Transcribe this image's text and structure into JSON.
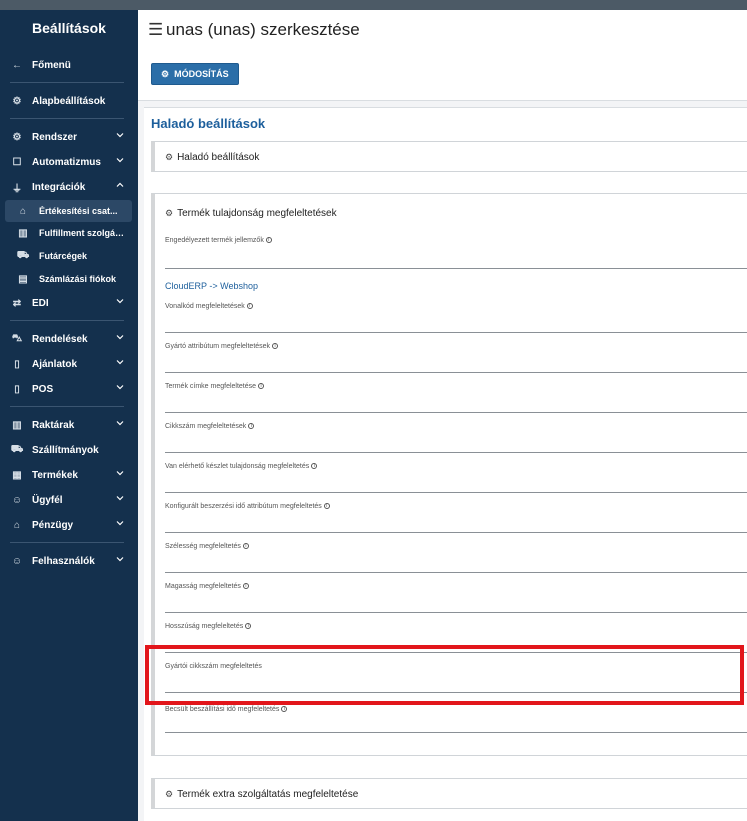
{
  "sidebar": {
    "title": "Beállítások",
    "back": "Főmenü",
    "items": [
      {
        "label": "Alapbeállítások",
        "icon": "gear-icon"
      },
      {
        "label": "Rendszer",
        "icon": "settings-icon"
      },
      {
        "label": "Automatizmus",
        "icon": "robot-icon"
      },
      {
        "label": "Integrációk",
        "icon": "plug-icon"
      },
      {
        "label": "Értékesítési csat...",
        "icon": "basket-icon"
      },
      {
        "label": "Fulfillment szolgált...",
        "icon": "warehouse-icon"
      },
      {
        "label": "Futárcégek",
        "icon": "truck-icon"
      },
      {
        "label": "Számlázási fiókok",
        "icon": "invoice-icon"
      },
      {
        "label": "EDI",
        "icon": "exchange-icon"
      },
      {
        "label": "Rendelések",
        "icon": "cart-icon"
      },
      {
        "label": "Ajánlatok",
        "icon": "document-icon"
      },
      {
        "label": "POS",
        "icon": "pos-icon"
      },
      {
        "label": "Raktárak",
        "icon": "warehouse-icon"
      },
      {
        "label": "Szállítmányok",
        "icon": "truck-icon"
      },
      {
        "label": "Termékek",
        "icon": "boxes-icon"
      },
      {
        "label": "Ügyfél",
        "icon": "users-icon"
      },
      {
        "label": "Pénzügy",
        "icon": "bank-icon"
      },
      {
        "label": "Felhasználók",
        "icon": "users-icon"
      }
    ]
  },
  "header": {
    "title": "unas (unas) szerkesztése",
    "save_label": "MÓDOSÍTÁS"
  },
  "card": {
    "title": "Haladó beállítások",
    "panel1_title": "Haladó beállítások",
    "panel2_title": "Termék tulajdonság megfeleltetések",
    "allowed_label": "Engedélyezett termék jellemzők",
    "section_link": "CloudERP -> Webshop",
    "fields": [
      "Vonalkód megfeleltetések",
      "Gyártó attribútum megfeleltetések",
      "Termék címke megfeleltetése",
      "Cikkszám megfeleltetések",
      "Van elérhető készlet tulajdonság megfeleltetés",
      "Konfigurált beszerzési idő attribútum megfeleltetés",
      "Szélesség megfeleltetés",
      "Magasság megfeleltetés",
      "Hosszúság megfeleltetés",
      "Gyártói cikkszám megfeleltetés",
      "Becsült beszállítási idő megfeleltetés"
    ],
    "panel3_title": "Termék extra szolgáltatás megfeleltetése"
  },
  "colors": {
    "sidebar_bg": "#14304d",
    "accent": "#2b6ea8",
    "title_blue": "#1d5f9c",
    "highlight": "#e2161b"
  }
}
